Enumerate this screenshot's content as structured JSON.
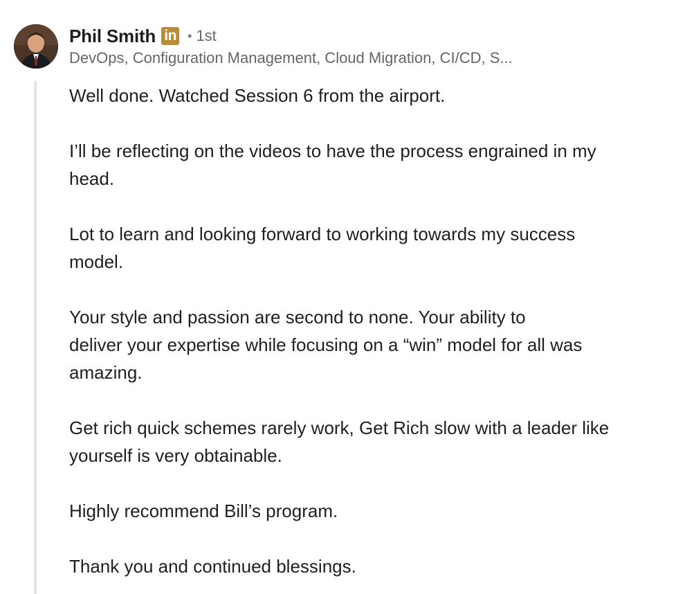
{
  "comment": {
    "author": {
      "name": "Phil Smith",
      "badge": "in",
      "separator": "•",
      "degree": "1st",
      "headline": "DevOps, Configuration Management, Cloud Migration, CI/CD, S..."
    },
    "paragraphs": [
      "Well done. Watched Session 6 from the airport.",
      "I’ll be reflecting on the videos to have the process engrained in my\nhead.",
      "Lot to learn and looking forward to working towards my success\nmodel.",
      "Your style and passion are second to none. Your ability to\ndeliver your expertise while focusing on a “win” model for all was\namazing.",
      "Get rich quick schemes rarely work, Get Rich slow with a leader like\nyourself is very obtainable.",
      "Highly recommend Bill’s program.",
      "Thank you and continued blessings."
    ]
  },
  "colors": {
    "badge": "#b98a3a",
    "thread_line": "#e6e4de",
    "text": "#1f1f1f",
    "secondary_text": "#666666"
  },
  "icons": {
    "avatar": "profile-photo",
    "badge": "linkedin-premium-icon"
  }
}
